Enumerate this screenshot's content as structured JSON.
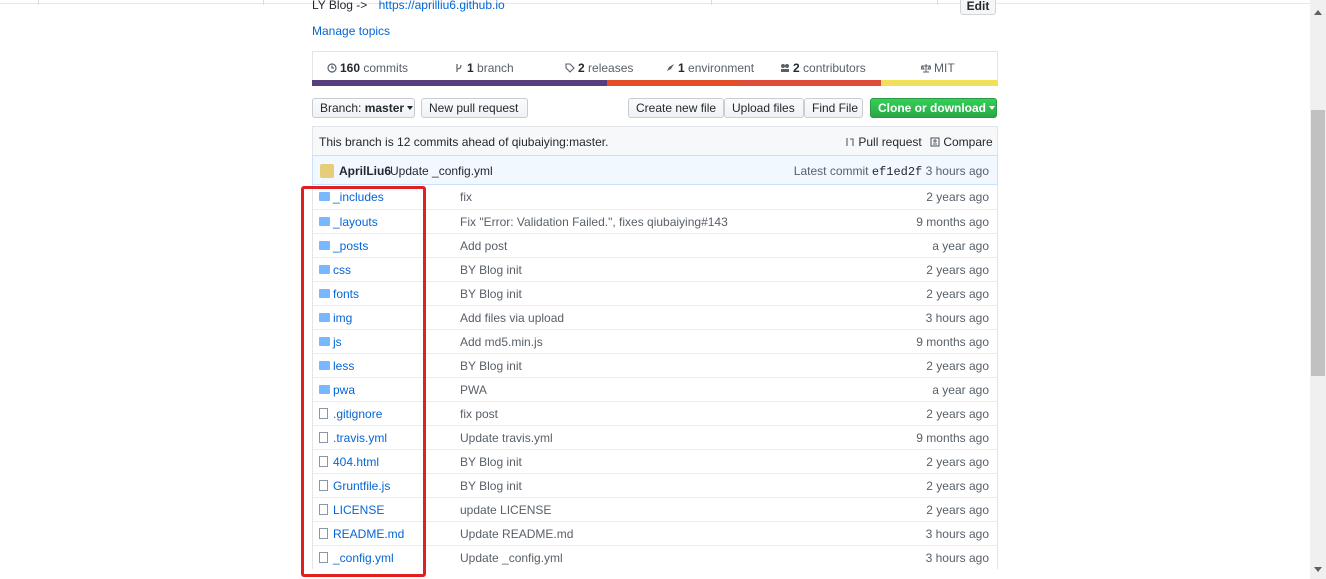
{
  "repo_meta": {
    "description": "LY Blog ->",
    "website": "https://aprilliu6.github.io",
    "edit_label": "Edit",
    "manage_topics": "Manage topics"
  },
  "summary": {
    "commits_count": "160",
    "commits_label": "commits",
    "branch_count": "1",
    "branch_label": "branch",
    "releases_count": "2",
    "releases_label": "releases",
    "environment_count": "1",
    "environment_label": "environment",
    "contributors_count": "2",
    "contributors_label": "contributors",
    "license": "MIT"
  },
  "language_bar": [
    {
      "color": "#563d7c",
      "share": 0.43
    },
    {
      "color": "#e34c26",
      "share": 0.19
    },
    {
      "color": "#dd4b39",
      "share": 0.21
    },
    {
      "color": "#f1e05a",
      "share": 0.17
    }
  ],
  "toolbar": {
    "branch_prefix": "Branch:",
    "branch_name": "master",
    "new_pull_request": "New pull request",
    "create_new_file": "Create new file",
    "upload_files": "Upload files",
    "find_file": "Find File",
    "clone_or_download": "Clone or download"
  },
  "branch_info": {
    "text": "This branch is 12 commits ahead of qiubaiying:master.",
    "pull_request": "Pull request",
    "compare": "Compare"
  },
  "latest_commit": {
    "author": "AprilLiu6",
    "message": "Update _config.yml",
    "latest_label": "Latest commit",
    "sha": "ef1ed2f",
    "age": "3 hours ago"
  },
  "files": [
    {
      "type": "folder",
      "name": "_includes",
      "message": "fix",
      "age": "2 years ago"
    },
    {
      "type": "folder",
      "name": "_layouts",
      "message": "Fix \"Error: Validation Failed.\", fixes qiubaiying#143",
      "age": "9 months ago"
    },
    {
      "type": "folder",
      "name": "_posts",
      "message": "Add post",
      "age": "a year ago"
    },
    {
      "type": "folder",
      "name": "css",
      "message": "BY Blog init",
      "age": "2 years ago"
    },
    {
      "type": "folder",
      "name": "fonts",
      "message": "BY Blog init",
      "age": "2 years ago"
    },
    {
      "type": "folder",
      "name": "img",
      "message": "Add files via upload",
      "age": "3 hours ago"
    },
    {
      "type": "folder",
      "name": "js",
      "message": "Add md5.min.js",
      "age": "9 months ago"
    },
    {
      "type": "folder",
      "name": "less",
      "message": "BY Blog init",
      "age": "2 years ago"
    },
    {
      "type": "folder",
      "name": "pwa",
      "message": "PWA",
      "age": "a year ago"
    },
    {
      "type": "file",
      "name": ".gitignore",
      "message": "fix post",
      "age": "2 years ago"
    },
    {
      "type": "file",
      "name": ".travis.yml",
      "message": "Update travis.yml",
      "age": "9 months ago"
    },
    {
      "type": "file",
      "name": "404.html",
      "message": "BY Blog init",
      "age": "2 years ago"
    },
    {
      "type": "file",
      "name": "Gruntfile.js",
      "message": "BY Blog init",
      "age": "2 years ago"
    },
    {
      "type": "file",
      "name": "LICENSE",
      "message": "update LICENSE",
      "age": "2 years ago"
    },
    {
      "type": "file",
      "name": "README.md",
      "message": "Update README.md",
      "age": "3 hours ago"
    },
    {
      "type": "file",
      "name": "_config.yml",
      "message": "Update _config.yml",
      "age": "3 hours ago"
    }
  ],
  "colors": {
    "link": "#0366d6",
    "green_button": "#28a745",
    "highlight": "#e02020"
  }
}
